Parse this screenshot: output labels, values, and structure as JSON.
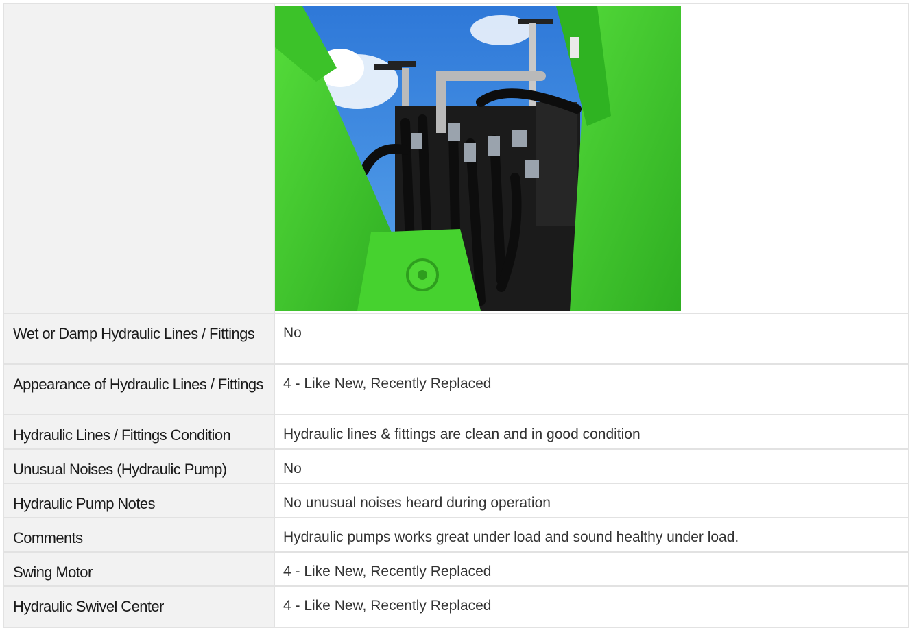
{
  "photo": {
    "alt": "Hydraulic lines and fittings on green excavator",
    "colors": {
      "sky": "#3a85e0",
      "machine_green": "#3fc92e",
      "hose": "#111111"
    }
  },
  "rows": [
    {
      "label": "Wet or Damp Hydraulic Lines / Fittings",
      "value": "No"
    },
    {
      "label": "Appearance of Hydraulic Lines / Fittings",
      "value": "4 - Like New, Recently Replaced"
    },
    {
      "label": "Hydraulic Lines / Fittings Condition",
      "value": "Hydraulic lines & fittings are clean and in good condition"
    },
    {
      "label": "Unusual Noises (Hydraulic Pump)",
      "value": "No"
    },
    {
      "label": "Hydraulic Pump Notes",
      "value": "No unusual noises heard during operation"
    },
    {
      "label": "Comments",
      "value": "Hydraulic pumps works great under load and sound healthy under load."
    },
    {
      "label": "Swing Motor",
      "value": "4 - Like New, Recently Replaced"
    },
    {
      "label": "Hydraulic Swivel Center",
      "value": "4 - Like New, Recently Replaced"
    }
  ]
}
